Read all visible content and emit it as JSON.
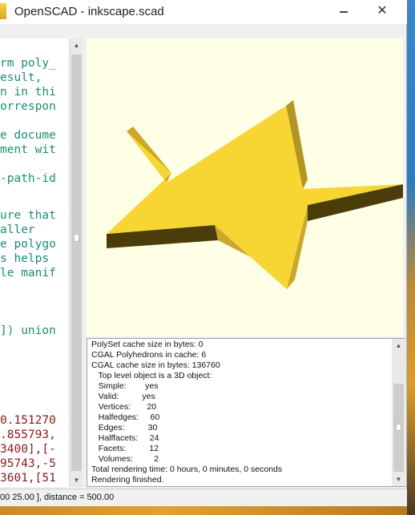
{
  "window": {
    "title": "OpenSCAD - inkscape.scad",
    "minimize_label": "",
    "close_label": "✕"
  },
  "editor": {
    "lines": [
      {
        "text": "rm poly_",
        "color": "green"
      },
      {
        "text": "esult,",
        "color": "green"
      },
      {
        "text": "n in thi",
        "color": "green"
      },
      {
        "text": "orrespon",
        "color": "green"
      },
      {
        "text": "",
        "color": "green"
      },
      {
        "text": "e docume",
        "color": "green"
      },
      {
        "text": "ment wit",
        "color": "green"
      },
      {
        "text": "",
        "color": "green"
      },
      {
        "text": "-path-id",
        "color": "green"
      },
      {
        "text": "",
        "color": "green"
      },
      {
        "text": "ure that",
        "color": "green"
      },
      {
        "text": "aller",
        "color": "green"
      },
      {
        "text": "e polygo",
        "color": "green"
      },
      {
        "text": "s helps",
        "color": "green"
      },
      {
        "text": "le manif",
        "color": "green"
      },
      {
        "text": "",
        "color": "green"
      },
      {
        "text": "",
        "color": "green"
      },
      {
        "text": "",
        "color": "green"
      },
      {
        "text": "]) union",
        "color": "green"
      },
      {
        "text": "",
        "color": "green"
      },
      {
        "text": "",
        "color": "green"
      },
      {
        "text": "0.151270",
        "color": "red"
      },
      {
        "text": ".855793,",
        "color": "red"
      },
      {
        "text": "3400],[-",
        "color": "red"
      },
      {
        "text": "95743,-5",
        "color": "red"
      },
      {
        "text": "3601,[51",
        "color": "red"
      }
    ]
  },
  "console": {
    "lines": [
      "PolySet cache size in bytes: 0",
      "CGAL Polyhedrons in cache: 6",
      "CGAL cache size in bytes: 136760",
      "   Top level object is a 3D object:",
      "   Simple:        yes",
      "   Valid:          yes",
      "   Vertices:       20",
      "   Halfedges:     60",
      "   Edges:          30",
      "   Halffacets:     24",
      "   Facets:          12",
      "   Volumes:         2",
      "Total rendering time: 0 hours, 0 minutes, 0 seconds",
      "Rendering finished."
    ]
  },
  "status": {
    "text": "00 25.00 ], distance = 500.00"
  },
  "scrollbar": {
    "up_arrow": "▲",
    "down_arrow": "▼"
  },
  "colors": {
    "viewport_bg": "#ffffe5",
    "star_top": "#f7d634",
    "star_side_lit": "#c9a82c",
    "star_side_dark": "#4a3d0a",
    "code_green": "#1c8d76",
    "code_red": "#8b1a1a"
  }
}
